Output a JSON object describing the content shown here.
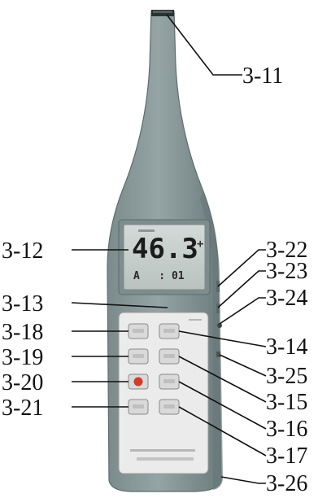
{
  "device": {
    "display_reading": "46.3",
    "display_suffix": "+",
    "display_sub": "A   : 01",
    "colors": {
      "body": "#8a9a9b",
      "body_shadow": "#6d7c7d",
      "lcd": "#c9d1cf",
      "keypad": "#e8e8e8",
      "red_key": "#d33a2c"
    }
  },
  "callouts": [
    {
      "id": "3-11",
      "label": "3-11"
    },
    {
      "id": "3-12",
      "label": "3-12"
    },
    {
      "id": "3-13",
      "label": "3-13"
    },
    {
      "id": "3-18",
      "label": "3-18"
    },
    {
      "id": "3-19",
      "label": "3-19"
    },
    {
      "id": "3-20",
      "label": "3-20"
    },
    {
      "id": "3-21",
      "label": "3-21"
    },
    {
      "id": "3-22",
      "label": "3-22"
    },
    {
      "id": "3-23",
      "label": "3-23"
    },
    {
      "id": "3-24",
      "label": "3-24"
    },
    {
      "id": "3-14",
      "label": "3-14"
    },
    {
      "id": "3-25",
      "label": "3-25"
    },
    {
      "id": "3-15",
      "label": "3-15"
    },
    {
      "id": "3-16",
      "label": "3-16"
    },
    {
      "id": "3-17",
      "label": "3-17"
    },
    {
      "id": "3-26",
      "label": "3-26"
    }
  ]
}
